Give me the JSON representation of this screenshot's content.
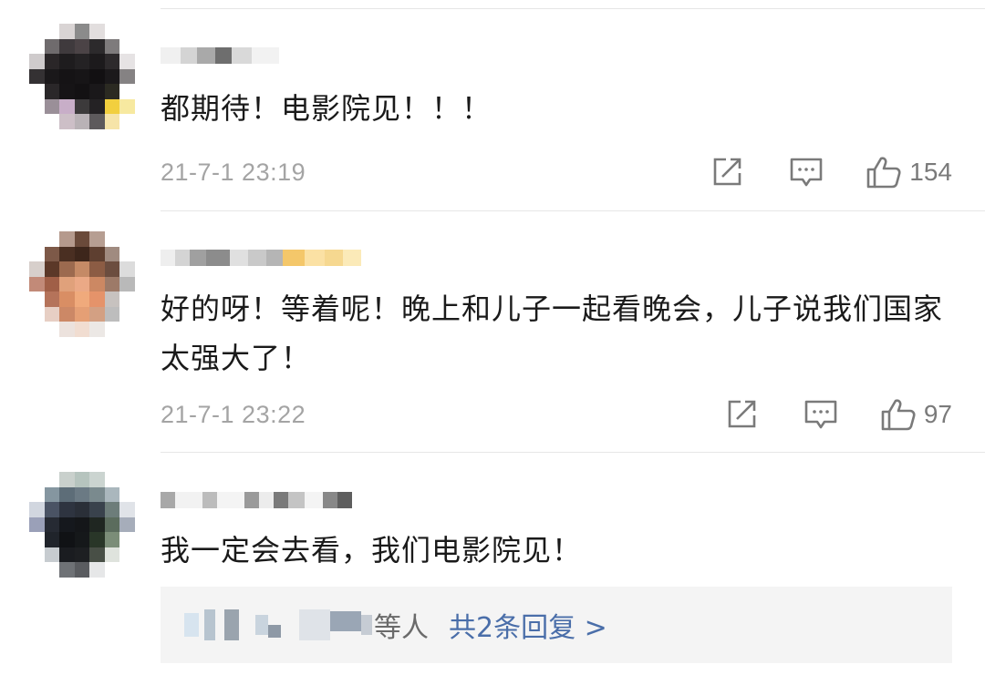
{
  "comments": [
    {
      "text": "都期待！电影院见！！！",
      "time": "21-7-1 23:19",
      "likes": "154"
    },
    {
      "text": "好的呀！等着呢！晚上和儿子一起看晚会，儿子说我们国家太强大了！",
      "time": "21-7-1 23:22",
      "likes": "97"
    },
    {
      "text": "我一定会去看，我们电影院见！"
    }
  ],
  "replies": {
    "suffix": "等人",
    "link": "共2条回复 >"
  },
  "icons": {
    "share": "share-icon",
    "comment": "comment-icon",
    "like": "thumbs-up-icon"
  },
  "colors": {
    "link": "#4a6ea9",
    "meta": "#a4a4a4"
  }
}
